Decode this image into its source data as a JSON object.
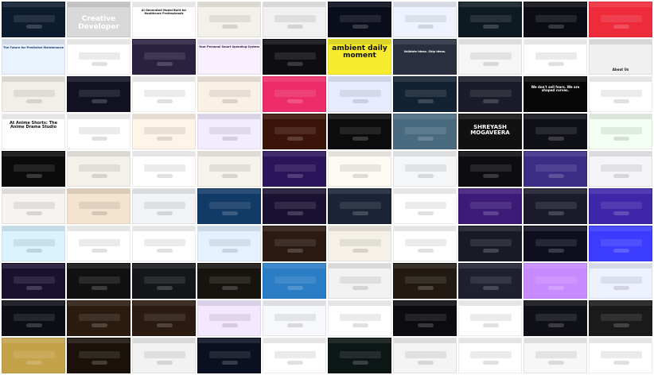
{
  "gallery": {
    "tiles": [
      {
        "bg": "#0d1b2e",
        "dark": true
      },
      {
        "bg": "#d9d9d9",
        "text": "Creative Developer",
        "tc": "#ffffff",
        "fs": 9,
        "ty": 0.38,
        "dark": false
      },
      {
        "bg": "#ffffff",
        "text": "AI Generated Model Built for Healthcare Professionals",
        "tc": "#111111",
        "fs": 3.5,
        "ty": 0.2,
        "dark": false
      },
      {
        "bg": "#f4f1ea",
        "dark": false
      },
      {
        "bg": "#f1f1f1",
        "dark": false
      },
      {
        "bg": "#0a0d1a",
        "dark": true
      },
      {
        "bg": "#eef3ff",
        "dark": false
      },
      {
        "bg": "#0e1a22",
        "dark": true
      },
      {
        "bg": "#0c0c14",
        "dark": true
      },
      {
        "bg": "#ee2b3b",
        "dark": true
      },
      {
        "bg": "#e9f3ff",
        "text": "The Future for Predictive Maintenance",
        "tc": "#1b3a70",
        "fs": 3.5,
        "ty": 0.2,
        "dark": false
      },
      {
        "bg": "#ffffff",
        "dark": false
      },
      {
        "bg": "#2a2140",
        "dark": true
      },
      {
        "bg": "#f8f0ff",
        "text": "Your Personal Smart Spending System",
        "tc": "#2a1a4a",
        "fs": 3.5,
        "ty": 0.18,
        "dark": false
      },
      {
        "bg": "#0e0e12",
        "dark": true
      },
      {
        "bg": "#f6ec2d",
        "text": "ambient daily moment",
        "tc": "#111111",
        "fs": 9,
        "ty": 0.15,
        "dark": false
      },
      {
        "bg": "#2a2f3f",
        "text": "Validate Ideas. Ship Ideas.",
        "tc": "#ffffff",
        "fs": 3.5,
        "ty": 0.3,
        "dark": true
      },
      {
        "bg": "#f6f6f6",
        "dark": false
      },
      {
        "bg": "#ffffff",
        "dark": false
      },
      {
        "bg": "#f0f0f0",
        "text": "About Us",
        "tc": "#111111",
        "fs": 4,
        "ty": 0.8,
        "dark": false
      },
      {
        "bg": "#f2efe8",
        "dark": false
      },
      {
        "bg": "#111122",
        "dark": true
      },
      {
        "bg": "#ffffff",
        "dark": false
      },
      {
        "bg": "#faf1e6",
        "dark": false
      },
      {
        "bg": "#ee2c6a",
        "dark": true
      },
      {
        "bg": "#e8eaff",
        "dark": false
      },
      {
        "bg": "#122233",
        "dark": true
      },
      {
        "bg": "#1b1b2a",
        "dark": true
      },
      {
        "bg": "#070707",
        "text": "We don't sell fears. We are shaped curves.",
        "tc": "#ffffff",
        "fs": 4,
        "ty": 0.25,
        "dark": true
      },
      {
        "bg": "#ffffff",
        "dark": false
      },
      {
        "bg": "#ffffff",
        "text": "At Anime Shorts: The Anime Drama Studio",
        "tc": "#111111",
        "fs": 5,
        "ty": 0.2,
        "dark": false
      },
      {
        "bg": "#ffffff",
        "dark": false
      },
      {
        "bg": "#fff4e8",
        "dark": false
      },
      {
        "bg": "#f2ecff",
        "dark": false
      },
      {
        "bg": "#3a1408",
        "dark": true
      },
      {
        "bg": "#0c0c0c",
        "dark": true
      },
      {
        "bg": "#4a6a80",
        "dark": true
      },
      {
        "bg": "#111111",
        "text": "SHREYASH MOGAVEERA",
        "tc": "#ffffff",
        "fs": 7,
        "ty": 0.28,
        "dark": true
      },
      {
        "bg": "#101018",
        "dark": true
      },
      {
        "bg": "#f4fff4",
        "dark": false
      },
      {
        "bg": "#0b0b0b",
        "dark": true
      },
      {
        "bg": "#f3f1ea",
        "dark": false
      },
      {
        "bg": "#ffffff",
        "dark": false
      },
      {
        "bg": "#f6f2ec",
        "dark": false
      },
      {
        "bg": "#2c145a",
        "dark": true
      },
      {
        "bg": "#fdfaf4",
        "dark": false
      },
      {
        "bg": "#f4f6f8",
        "dark": false
      },
      {
        "bg": "#0d0d10",
        "dark": true
      },
      {
        "bg": "#3b2d86",
        "dark": true
      },
      {
        "bg": "#f4f4f9",
        "dark": false
      },
      {
        "bg": "#f6f3f0",
        "dark": false
      },
      {
        "bg": "#f3e3cf",
        "dark": false
      },
      {
        "bg": "#f1f3f6",
        "dark": false
      },
      {
        "bg": "#123a66",
        "dark": true
      },
      {
        "bg": "#1a1233",
        "dark": true
      },
      {
        "bg": "#1a2436",
        "dark": true
      },
      {
        "bg": "#ffffff",
        "dark": false
      },
      {
        "bg": "#3b1a78",
        "dark": true
      },
      {
        "bg": "#1b1b2c",
        "dark": true
      },
      {
        "bg": "#3d26a8",
        "dark": true
      },
      {
        "bg": "#d9f3ff",
        "dark": false
      },
      {
        "bg": "#ffffff",
        "dark": false
      },
      {
        "bg": "#ffffff",
        "dark": false
      },
      {
        "bg": "#e4f2ff",
        "dark": false
      },
      {
        "bg": "#2a1a12",
        "dark": true
      },
      {
        "bg": "#f5f1e8",
        "dark": false
      },
      {
        "bg": "#ffffff",
        "dark": false
      },
      {
        "bg": "#1a1a26",
        "dark": true
      },
      {
        "bg": "#0e0e1e",
        "dark": true
      },
      {
        "bg": "#3c3cff",
        "dark": true
      },
      {
        "bg": "#1a1030",
        "dark": true
      },
      {
        "bg": "#111111",
        "dark": true
      },
      {
        "bg": "#14161a",
        "dark": true
      },
      {
        "bg": "#17140f",
        "dark": true
      },
      {
        "bg": "#2a7cc4",
        "dark": true
      },
      {
        "bg": "#f2f2f2",
        "dark": false
      },
      {
        "bg": "#221a12",
        "dark": true
      },
      {
        "bg": "#1e2030",
        "dark": true
      },
      {
        "bg": "#c88bff",
        "dark": true
      },
      {
        "bg": "#eef2ff",
        "dark": false
      },
      {
        "bg": "#0d0d16",
        "dark": true
      },
      {
        "bg": "#2b1b0f",
        "dark": true
      },
      {
        "bg": "#2a1a0f",
        "dark": true
      },
      {
        "bg": "#f2e8ff",
        "dark": false
      },
      {
        "bg": "#f7f8fb",
        "dark": false
      },
      {
        "bg": "#ffffff",
        "dark": false
      },
      {
        "bg": "#0b0b10",
        "dark": true
      },
      {
        "bg": "#ffffff",
        "dark": false
      },
      {
        "bg": "#101018",
        "dark": true
      },
      {
        "bg": "#1a1a1a",
        "dark": true
      },
      {
        "bg": "#c4a24a",
        "dark": true
      },
      {
        "bg": "#1a120a",
        "dark": true
      },
      {
        "bg": "#f2f2f2",
        "dark": false
      },
      {
        "bg": "#0a1020",
        "dark": true
      },
      {
        "bg": "#ffffff",
        "dark": false
      },
      {
        "bg": "#0c1614",
        "dark": true
      },
      {
        "bg": "#f4f4f4",
        "dark": false
      },
      {
        "bg": "#ffffff",
        "dark": false
      },
      {
        "bg": "#f7f7f7",
        "dark": false
      },
      {
        "bg": "#ffffff",
        "dark": false
      }
    ]
  }
}
